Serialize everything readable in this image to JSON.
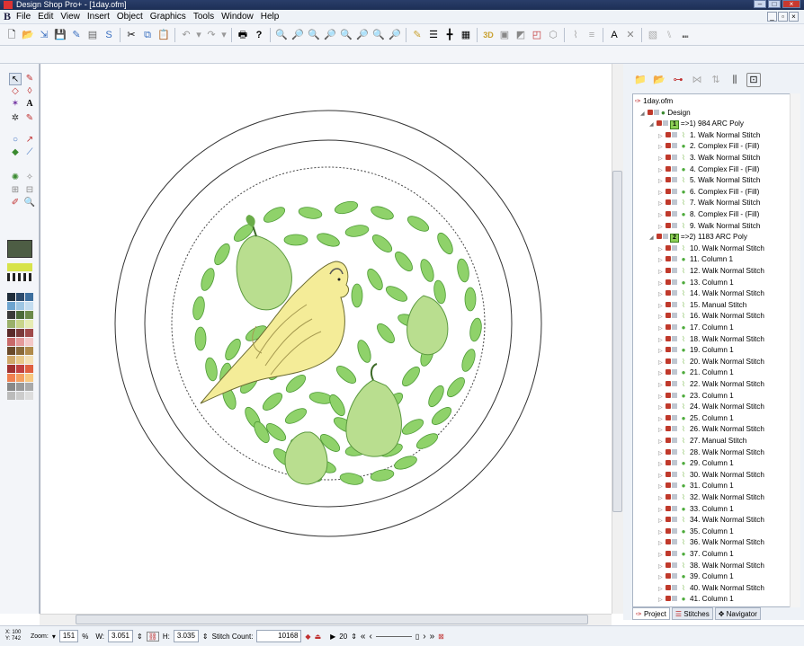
{
  "window": {
    "title": "Design Shop Pro+ - [1day.ofm]"
  },
  "menu": [
    "File",
    "Edit",
    "View",
    "Insert",
    "Object",
    "Graphics",
    "Tools",
    "Window",
    "Help"
  ],
  "toolbar_icons": [
    "new-icon",
    "open-icon",
    "import-icon",
    "save-icon",
    "cut-icon",
    "copy-icon",
    "paste-icon",
    "undo-icon",
    "redo-icon",
    "print-icon",
    "help-icon",
    "zoom-in-icon",
    "zoom-out-icon",
    "zoom-fit-icon",
    "grid-icon",
    "table-icon",
    "3d-icon",
    "hoop-icon",
    "select-icon"
  ],
  "tree": {
    "root": "1day.ofm",
    "design": "Design",
    "groups": [
      {
        "badge": "1",
        "label": "=>1) 984 ARC Poly",
        "items": [
          "1. Walk Normal Stitch",
          "2. Complex Fill - (Fill)",
          "3. Walk Normal Stitch",
          "4. Complex Fill - (Fill)",
          "5. Walk Normal Stitch",
          "6. Complex Fill - (Fill)",
          "7. Walk Normal Stitch",
          "8. Complex Fill - (Fill)",
          "9. Walk Normal Stitch"
        ]
      },
      {
        "badge": "2",
        "label": "=>2) 1183 ARC Poly",
        "items": [
          "10. Walk Normal Stitch",
          "11. Column 1",
          "12. Walk Normal Stitch",
          "13. Column 1",
          "14. Walk Normal Stitch",
          "15. Manual Stitch",
          "16. Walk Normal Stitch",
          "17. Column 1",
          "18. Walk Normal Stitch",
          "19. Column 1",
          "20. Walk Normal Stitch",
          "21. Column 1",
          "22. Walk Normal Stitch",
          "23. Column 1",
          "24. Walk Normal Stitch",
          "25. Column 1",
          "26. Walk Normal Stitch",
          "27. Manual Stitch",
          "28. Walk Normal Stitch",
          "29. Column 1",
          "30. Walk Normal Stitch",
          "31. Column 1",
          "32. Walk Normal Stitch",
          "33. Column 1",
          "34. Walk Normal Stitch",
          "35. Column 1",
          "36. Walk Normal Stitch",
          "37. Column 1",
          "38. Walk Normal Stitch",
          "39. Column 1",
          "40. Walk Normal Stitch",
          "41. Column 1"
        ]
      }
    ]
  },
  "tabs": [
    "Project",
    "Stitches",
    "Navigator"
  ],
  "status": {
    "x_label": "X:",
    "x_value": "100",
    "y_label": "Y:",
    "y_value": "742",
    "zoom_label": "Zoom:",
    "zoom_value": "151",
    "zoom_unit": "%",
    "w_label": "W:",
    "w_value": "3.051",
    "h_label": "H:",
    "h_value": "3.035",
    "stitch_count_label": "Stitch Count:",
    "stitch_count_value": "10168",
    "speed_value": "20"
  },
  "colors": {
    "leaf": "#8fd26a",
    "leaf_dark": "#4d9a35",
    "bird": "#f4ec98",
    "pear": "#b9de8f"
  }
}
